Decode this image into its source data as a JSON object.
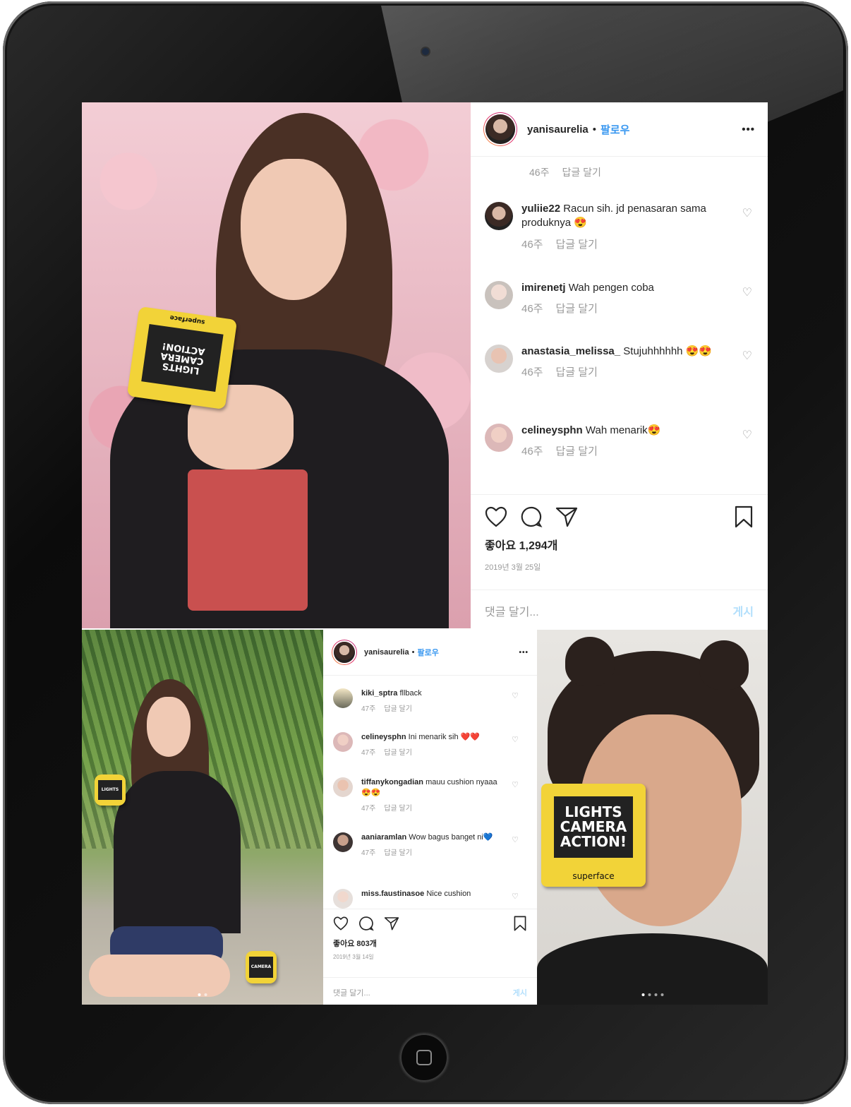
{
  "post_main": {
    "username": "yanisaurelia",
    "follow_label": "팔로우",
    "more_label": "•••",
    "top_meta": {
      "time": "46주",
      "reply": "답글 달기"
    },
    "comments": [
      {
        "user": "yuliie22",
        "text": "Racun sih. jd penasaran sama produknya 😍",
        "time": "46주",
        "reply": "답글 달기"
      },
      {
        "user": "imirenetj",
        "text": "Wah pengen coba",
        "time": "46주",
        "reply": "답글 달기"
      },
      {
        "user": "anastasia_melissa_",
        "text": "Stujuhhhhhh 😍😍",
        "time": "46주",
        "reply": "답글 달기"
      },
      {
        "user": "celineysphn",
        "text": "Wah menarik😍",
        "time": "46주",
        "reply": "답글 달기"
      }
    ],
    "likes": "좋아요 1,294개",
    "date": "2019년 3월 25일",
    "comment_placeholder": "댓글 달기...",
    "post_label": "게시"
  },
  "post_second": {
    "username": "yanisaurelia",
    "follow_label": "팔로우",
    "more_label": "•••",
    "comments": [
      {
        "user": "kiki_sptra",
        "text": "fllback",
        "time": "47주",
        "reply": "답글 달기"
      },
      {
        "user": "celineysphn",
        "text": "Ini menarik sih ❤️❤️",
        "time": "47주",
        "reply": "답글 달기"
      },
      {
        "user": "tiffanykongadian",
        "text": "mauu cushion nyaaa😍😍",
        "time": "47주",
        "reply": "답글 달기"
      },
      {
        "user": "aaniaramlan",
        "text": "Wow bagus banget ni💙",
        "time": "47주",
        "reply": "답글 달기"
      },
      {
        "user": "miss.faustinasoe",
        "text": "Nice cushion",
        "time": "",
        "reply": ""
      }
    ],
    "likes": "좋아요 803개",
    "date": "2019년 3월 14일",
    "comment_placeholder": "댓글 달기...",
    "post_label": "게시"
  },
  "product": {
    "brand": "superface",
    "slogan_lines": [
      "LIGHTS",
      "CAMERA",
      "ACTION!"
    ]
  },
  "colors": {
    "link": "#3897f0",
    "compact": "#f2d338",
    "text": "#262626",
    "muted": "#999999"
  }
}
